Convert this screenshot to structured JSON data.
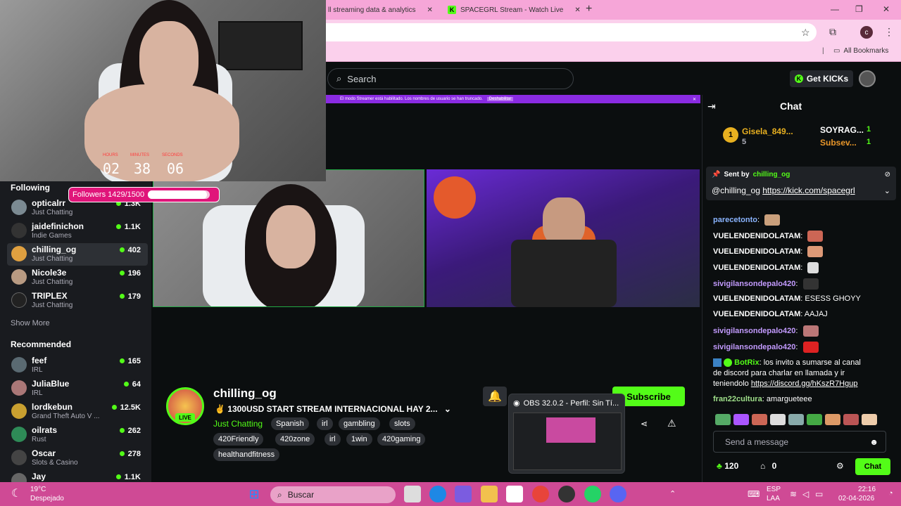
{
  "browser": {
    "tabs": [
      {
        "label": "ll streaming data & analytics"
      },
      {
        "label": "SPACEGRL Stream - Watch Live"
      }
    ],
    "new_tab": "+",
    "bookmarks_label": "All Bookmarks",
    "profile_letter": "c"
  },
  "header": {
    "search_placeholder": "Search",
    "get_kicks": "Get KICKs"
  },
  "streamer_banner": {
    "text": "El modo Streamer está habilitado. Los nombres de usuario se han truncado.",
    "button": "Deshabilitar"
  },
  "webcam": {
    "timer": {
      "labels": [
        "HOURS",
        "MINUTES",
        "SECONDS"
      ],
      "values": [
        "02",
        "38",
        "06"
      ]
    }
  },
  "followers_goal": {
    "text": "Followers 1429/1500",
    "progress": 0.953
  },
  "sidebar": {
    "following_title": "Following",
    "following": [
      {
        "name": "opticalrr",
        "category": "Just Chatting",
        "viewers": "1.3K"
      },
      {
        "name": "jaidefinichon",
        "category": "Indie Games",
        "viewers": "1.1K"
      },
      {
        "name": "chilling_og",
        "category": "Just Chatting",
        "viewers": "402"
      },
      {
        "name": "Nicole3e",
        "category": "Just Chatting",
        "viewers": "196"
      },
      {
        "name": "TRIPLEX",
        "category": "Just Chatting",
        "viewers": "179"
      }
    ],
    "show_more": "Show More",
    "recommended_title": "Recommended",
    "recommended": [
      {
        "name": "feef",
        "category": "IRL",
        "viewers": "165"
      },
      {
        "name": "JuliaBlue",
        "category": "IRL",
        "viewers": "64"
      },
      {
        "name": "lordkebun",
        "category": "Grand Theft Auto V ...",
        "viewers": "12.5K"
      },
      {
        "name": "oilrats",
        "category": "Rust",
        "viewers": "262"
      },
      {
        "name": "Oscar",
        "category": "Slots & Casino",
        "viewers": "278"
      },
      {
        "name": "Jay",
        "category": "",
        "viewers": "1.1K"
      }
    ]
  },
  "channel": {
    "name": "chilling_og",
    "live": "LIVE",
    "title": "✌ 1300USD START STREAM INTERNACIONAL HAY 2...",
    "category": "Just Chatting",
    "tags_row1": [
      "Spanish",
      "irl",
      "gambling",
      "slots"
    ],
    "tags_row2": [
      "420Friendly",
      "420zone",
      "irl",
      "1win",
      "420gaming"
    ],
    "tags_row3": [
      "healthandfitness"
    ],
    "subscribe": "Subscribe"
  },
  "obs_preview": {
    "title": "OBS 32.0.2 - Perfil: Sin Tí..."
  },
  "chat": {
    "title": "Chat",
    "gifters": [
      {
        "name": "Gisela_849...",
        "count": "5",
        "rank": "1"
      },
      {
        "name": "SOYRAG...",
        "count": "1"
      },
      {
        "name": "Subsev...",
        "count": "1"
      }
    ],
    "pinned": {
      "sent_by_label": "Sent by",
      "sender": "chilling_og",
      "mention": "@chilling_og",
      "link": "https://kick.com/spacegrl"
    },
    "messages": [
      {
        "user": "parecetonto",
        "text": "",
        "color": "#8ab4ff"
      },
      {
        "user": "VUELENDENIDOLATAM",
        "text": "",
        "color": "#ffffff"
      },
      {
        "user": "VUELENDENIDOLATAM",
        "text": "",
        "color": "#ffffff"
      },
      {
        "user": "VUELENDENIDOLATAM",
        "text": "",
        "color": "#ffffff"
      },
      {
        "user": "sivigilansondepalo420",
        "text": "",
        "color": "#c39bff"
      },
      {
        "user": "VUELENDENIDOLATAM",
        "text": "ESESS GHOYY",
        "color": "#ffffff"
      },
      {
        "user": "VUELENDENIDOLATAM",
        "text": "AAJAJ",
        "color": "#ffffff"
      },
      {
        "user": "sivigilansondepalo420",
        "text": "",
        "color": "#c39bff"
      },
      {
        "user": "sivigilansondepalo420",
        "text": "",
        "color": "#c39bff"
      }
    ],
    "botrix": {
      "user": "BotRix",
      "line1": "los invito a sumarse al canal",
      "line2": "de discord para charlar en llamada y ir",
      "line3": "teniendolo",
      "link": "https://discord.gg/hKszR7Hgup"
    },
    "last": {
      "user": "fran22cultura",
      "text": "amargueteee"
    },
    "input_placeholder": "Send a message",
    "kicks": "120",
    "drops": "0",
    "send": "Chat"
  },
  "taskbar": {
    "weather_temp": "19°C",
    "weather_text": "Despejado",
    "search": "Buscar",
    "lang": "ESP",
    "lang2": "LAA",
    "time": "22:16",
    "date": "02-04-2026"
  }
}
